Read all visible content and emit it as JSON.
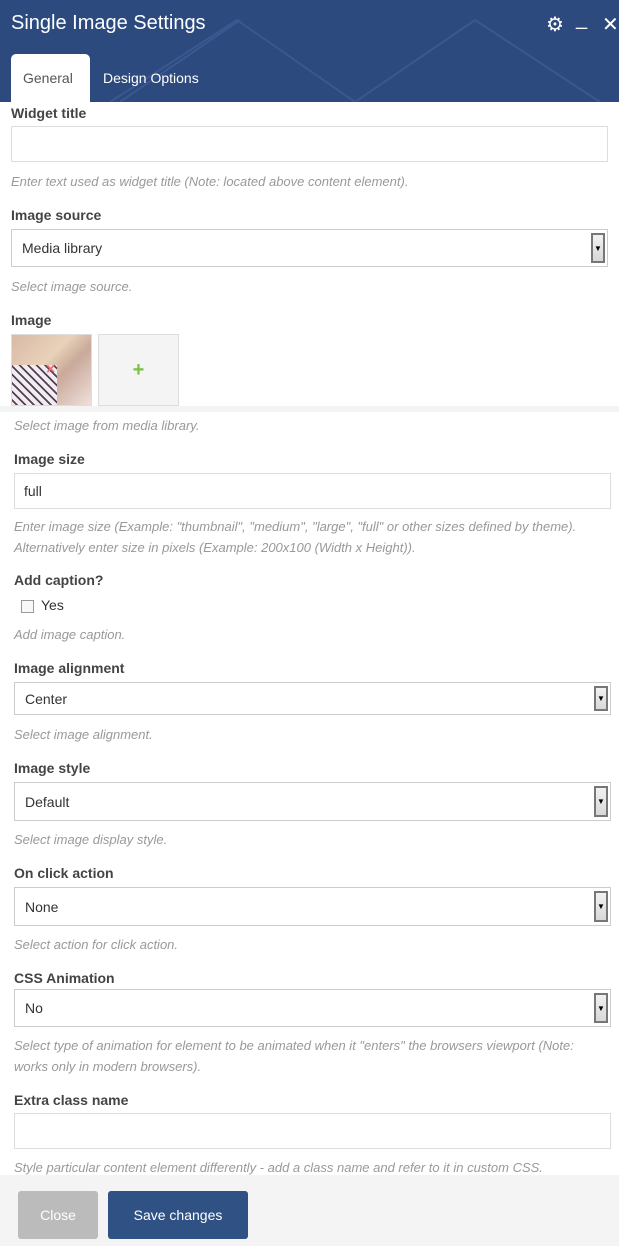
{
  "header": {
    "title": "Single Image Settings",
    "icons": [
      "gear-icon",
      "minimize-icon",
      "close-icon"
    ]
  },
  "tabs": [
    {
      "label": "General",
      "active": true
    },
    {
      "label": "Design Options",
      "active": false
    }
  ],
  "fields": {
    "widget_title": {
      "label": "Widget title",
      "value": "",
      "help": "Enter text used as widget title (Note: located above content element)."
    },
    "image_source": {
      "label": "Image source",
      "value": "Media library",
      "help": "Select image source."
    },
    "image": {
      "label": "Image",
      "add": "+",
      "remove": "×",
      "help": "Select image from media library."
    },
    "image_size": {
      "label": "Image size",
      "value": "full",
      "help": "Enter image size (Example: \"thumbnail\", \"medium\", \"large\", \"full\" or other sizes defined by theme). Alternatively enter size in pixels (Example: 200x100 (Width x Height))."
    },
    "add_caption": {
      "label": "Add caption?",
      "option": "Yes",
      "checked": false,
      "help": "Add image caption."
    },
    "image_alignment": {
      "label": "Image alignment",
      "value": "Center",
      "help": "Select image alignment."
    },
    "image_style": {
      "label": "Image style",
      "value": "Default",
      "help": "Select image display style."
    },
    "on_click": {
      "label": "On click action",
      "value": "None",
      "help": "Select action for click action."
    },
    "css_animation": {
      "label": "CSS Animation",
      "value": "No",
      "help": "Select type of animation for element to be animated when it \"enters\" the browsers viewport (Note: works only in modern browsers)."
    },
    "extra_class": {
      "label": "Extra class name",
      "value": "",
      "help": "Style particular content element differently - add a class name and refer to it in custom CSS."
    }
  },
  "footer": {
    "close": "Close",
    "save": "Save changes"
  },
  "colors": {
    "header": "#2c4a7e",
    "save": "#2f5183",
    "close": "#bbbbbb",
    "add": "#7ac143",
    "remove": "#ff6b6b"
  }
}
